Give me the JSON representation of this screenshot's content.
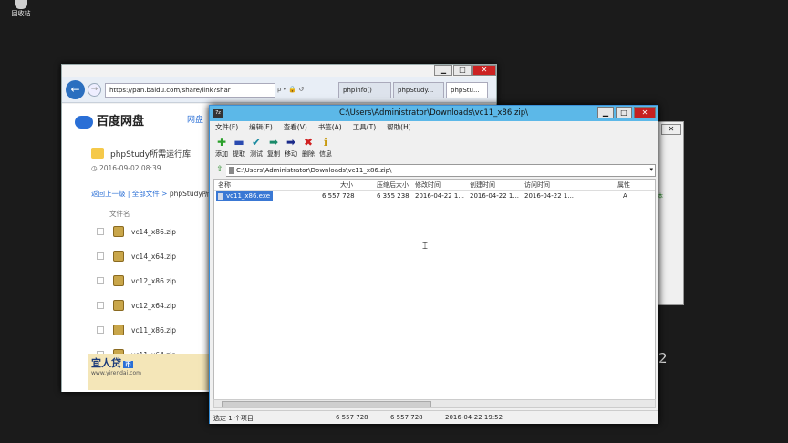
{
  "desktop": {
    "recycle_label": "回收站",
    "stray_text": "2"
  },
  "browser": {
    "url": "https://pan.baidu.com/share/link?shar",
    "url_controls": "ρ ▾ 🔒 ↺",
    "tabs": [
      "phpinfo()",
      "phpStudy...",
      "phpStu..."
    ],
    "brand": "百度网盘",
    "nav_link": "网盘",
    "folder_name": "phpStudy所需运行库",
    "folder_date": "2016-09-02 08:39",
    "breadcrumb": {
      "back": "返回上一级",
      "all": "全部文件",
      "current": "phpStudy所需"
    },
    "column_header": "文件名",
    "files": [
      "vc14_x86.zip",
      "vc14_x64.zip",
      "vc12_x86.zip",
      "vc12_x64.zip",
      "vc11_x86.zip",
      "vc11_x64.zip"
    ],
    "ad_brand": "宜人贷",
    "ad_badge": "币",
    "ad_domain": "www.yirendai.com"
  },
  "dialog_behind": {
    "note": "本"
  },
  "zip": {
    "title": "C:\\Users\\Administrator\\Downloads\\vc11_x86.zip\\",
    "icon_label": "7z",
    "menu": [
      "文件(F)",
      "编辑(E)",
      "查看(V)",
      "书签(A)",
      "工具(T)",
      "帮助(H)"
    ],
    "toolbar": [
      {
        "label": "添加",
        "icon": "plus-icon",
        "glyph": "✚",
        "color": "#2aa02a"
      },
      {
        "label": "提取",
        "icon": "minus-icon",
        "glyph": "▬",
        "color": "#2a4ab0"
      },
      {
        "label": "测试",
        "icon": "check-icon",
        "glyph": "✔",
        "color": "#1a8aa0"
      },
      {
        "label": "复制",
        "icon": "copy-arrow-icon",
        "glyph": "➡",
        "color": "#1a8a6a"
      },
      {
        "label": "移动",
        "icon": "move-arrow-icon",
        "glyph": "➡",
        "color": "#1a2a8a"
      },
      {
        "label": "删除",
        "icon": "delete-icon",
        "glyph": "✖",
        "color": "#d02020"
      },
      {
        "label": "信息",
        "icon": "info-icon",
        "glyph": "ℹ",
        "color": "#c89a10"
      }
    ],
    "path": "C:\\Users\\Administrator\\Downloads\\vc11_x86.zip\\",
    "columns": [
      "名称",
      "大小",
      "压缩后大小",
      "修改时间",
      "创建时间",
      "访问时间",
      "属性"
    ],
    "rows": [
      {
        "name": "vc11_x86.exe",
        "size": "6 557 728",
        "packed": "6 355 238",
        "modified": "2016-04-22 1...",
        "created": "2016-04-22 1...",
        "accessed": "2016-04-22 1...",
        "attr": "A"
      }
    ],
    "status": {
      "selected": "选定 1 个项目",
      "size": "6 557 728",
      "packed": "6 557 728",
      "date": "2016-04-22 19:52"
    }
  }
}
